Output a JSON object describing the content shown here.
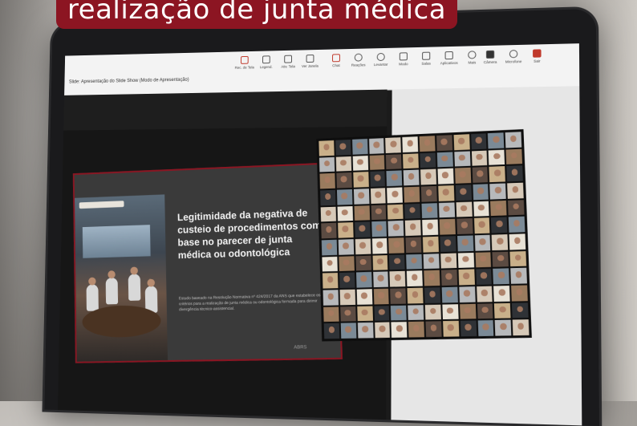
{
  "headline": "realização de junta médica",
  "window": {
    "document_title": "Slide: Apresentação do Slide Show (Modo de Apresentação)"
  },
  "toolbar": {
    "items": [
      {
        "label": "Rec. de Tela",
        "icon": "record-icon"
      },
      {
        "label": "Legend.",
        "icon": "captions-icon"
      },
      {
        "label": "Ativ. Tela",
        "icon": "share-screen-icon"
      },
      {
        "label": "Ver Janela",
        "icon": "window-icon"
      },
      {
        "label": "Chat",
        "icon": "chat-icon"
      },
      {
        "label": "Reações",
        "icon": "reactions-icon"
      },
      {
        "label": "Levantar",
        "icon": "raise-hand-icon"
      },
      {
        "label": "Modo",
        "icon": "view-mode-icon"
      },
      {
        "label": "Salas",
        "icon": "rooms-icon"
      },
      {
        "label": "Aplicativos",
        "icon": "apps-icon"
      },
      {
        "label": "Mais",
        "icon": "more-icon"
      },
      {
        "label": "Câmera",
        "icon": "camera-icon"
      },
      {
        "label": "Microfone",
        "icon": "microphone-icon"
      },
      {
        "label": "Sair",
        "icon": "leave-icon"
      }
    ]
  },
  "slide": {
    "title": "Legitimidade da negativa de custeio de procedimentos com base no parecer de junta médica ou odontológica",
    "body": "Estudo baseado na Resolução Normativa nº 424/2017 da ANS que estabelece os critérios para a realização de junta médica ou odontológica formada para dirimir divergência técnico-assistencial.",
    "logo": "ABRS"
  },
  "colors": {
    "accent": "#8c1522",
    "screen_bg": "#1b1b1b",
    "toolbar_bg": "#f3f3f3"
  }
}
